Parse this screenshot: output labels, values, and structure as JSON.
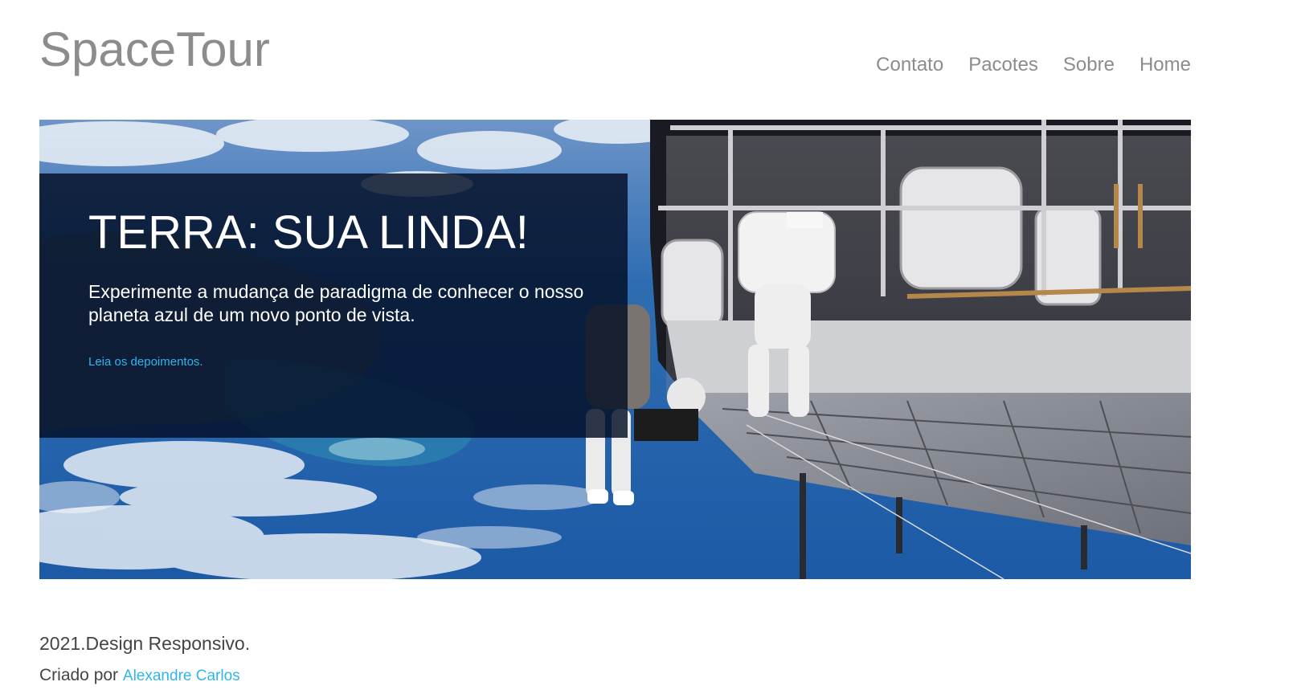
{
  "header": {
    "logo": "SpaceTour",
    "nav": [
      {
        "label": "Contato"
      },
      {
        "label": "Pacotes"
      },
      {
        "label": "Sobre"
      },
      {
        "label": "Home"
      }
    ]
  },
  "hero": {
    "title": "TERRA: SUA LINDA!",
    "text": "Experimente a mudança de paradigma de conhecer o nosso planeta azul de um novo ponto de vista.",
    "link": "Leia os depoimentos."
  },
  "footer": {
    "line1": "2021.Design Responsivo.",
    "created_by": "Criado por",
    "author": "Alexandre Carlos"
  },
  "colors": {
    "logo": "#8c8c8c",
    "link": "#2fb5ef",
    "card_bg": "#020e24"
  }
}
